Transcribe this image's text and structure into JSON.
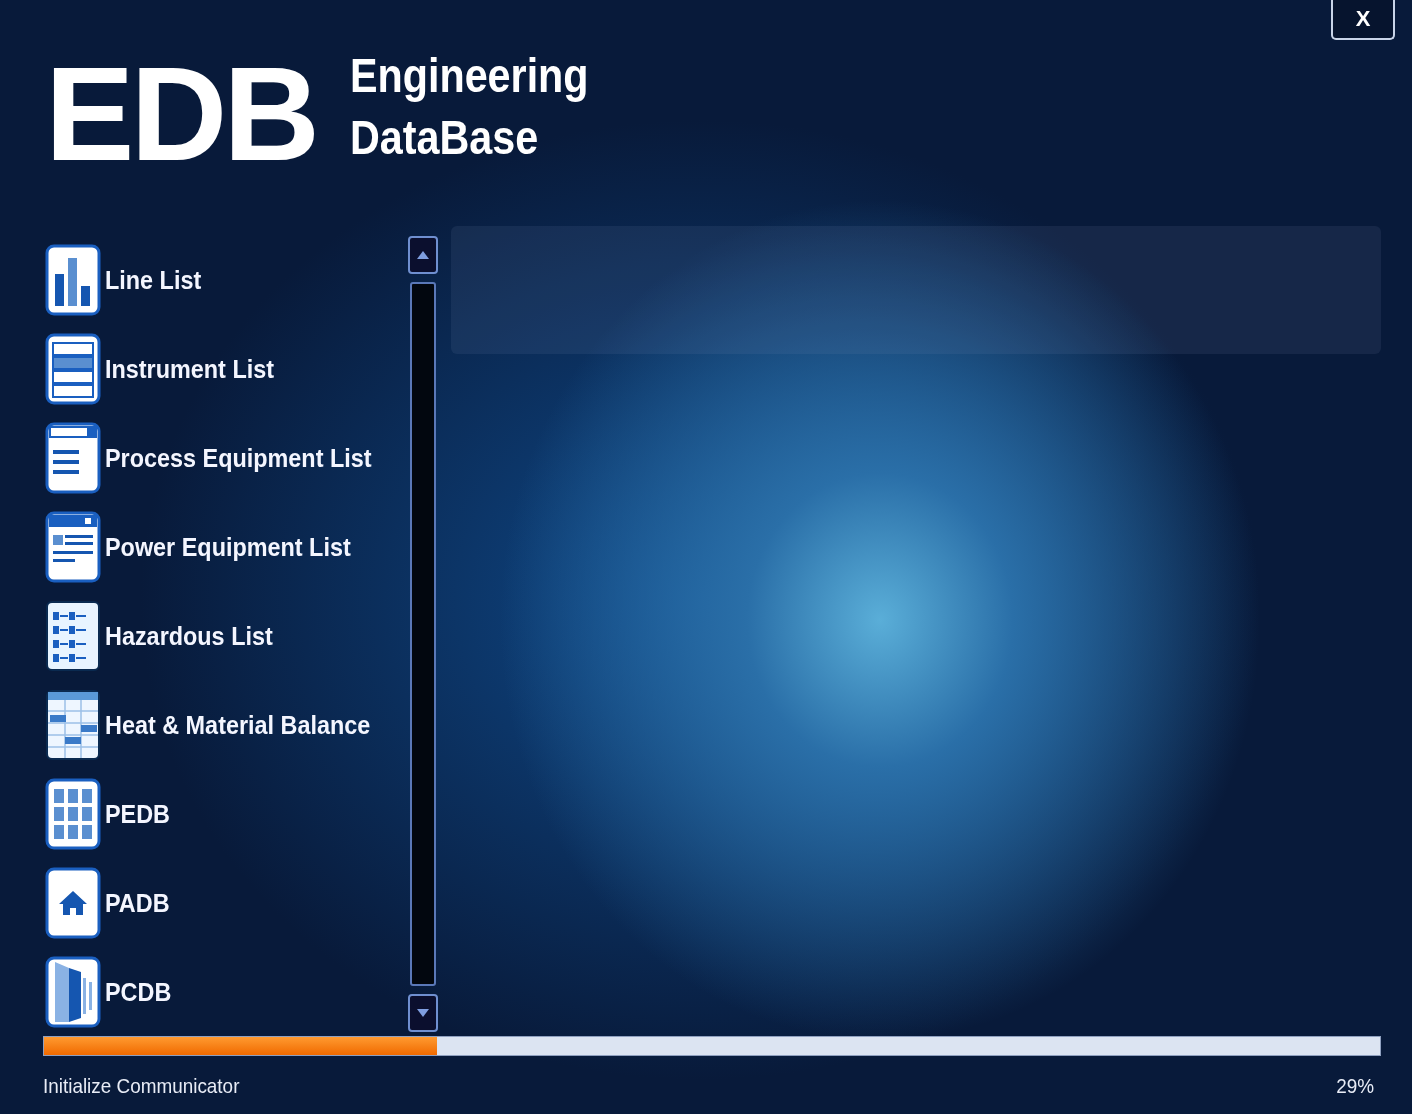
{
  "close_button": "X",
  "logo": {
    "mark": "EDB",
    "line_1": "Engineering",
    "line_2": "DataBase"
  },
  "modules": [
    {
      "label": "Line List"
    },
    {
      "label": "Instrument List"
    },
    {
      "label": "Process Equipment List"
    },
    {
      "label": "Power Equipment List"
    },
    {
      "label": "Hazardous List"
    },
    {
      "label": "Heat & Material Balance"
    },
    {
      "label": "PEDB"
    },
    {
      "label": "PADB"
    },
    {
      "label": "PCDB"
    }
  ],
  "progress": {
    "level": 0.294,
    "status": "Initialize Communicator",
    "percent": "29%"
  }
}
